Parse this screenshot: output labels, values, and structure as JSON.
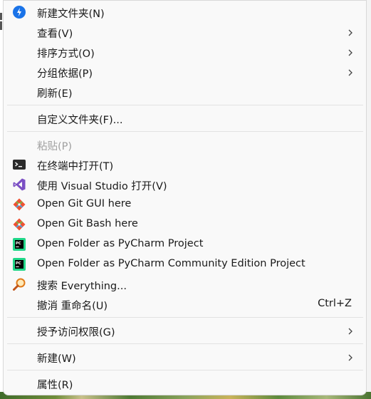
{
  "menu": {
    "items": [
      {
        "label": "新建文件夹(N)",
        "icon": "new-folder-icon"
      },
      {
        "label": "查看(V)",
        "submenu": true
      },
      {
        "label": "排序方式(O)",
        "submenu": true
      },
      {
        "label": "分组依据(P)",
        "submenu": true
      },
      {
        "label": "刷新(E)"
      },
      {
        "label": "自定义文件夹(F)..."
      },
      {
        "label": "粘贴(P)",
        "disabled": true
      },
      {
        "label": "在终端中打开(T)",
        "icon": "terminal-icon"
      },
      {
        "label": "使用 Visual Studio 打开(V)",
        "icon": "visual-studio-icon"
      },
      {
        "label": "Open Git GUI here",
        "icon": "git-gui-icon"
      },
      {
        "label": "Open Git Bash here",
        "icon": "git-bash-icon"
      },
      {
        "label": "Open Folder as PyCharm Project",
        "icon": "pycharm-icon"
      },
      {
        "label": "Open Folder as PyCharm Community Edition Project",
        "icon": "pycharm-ce-icon"
      },
      {
        "label": "搜索 Everything...",
        "icon": "everything-search-icon"
      },
      {
        "label": "撤消 重命名(U)",
        "shortcut": "Ctrl+Z"
      },
      {
        "label": "授予访问权限(G)",
        "submenu": true
      },
      {
        "label": "新建(W)",
        "submenu": true
      },
      {
        "label": "属性(R)"
      }
    ]
  },
  "colors": {
    "menu_bg": "#f9f9f9",
    "text": "#1a1a1a",
    "disabled_text": "#a0a0a0",
    "separator": "#e2e2e2",
    "accent_blue": "#1a73e8",
    "vs_purple": "#7b4fc4",
    "git_orange": "#f05133",
    "pycharm_green": "#21d789",
    "everything_orange": "#e07b1a"
  }
}
